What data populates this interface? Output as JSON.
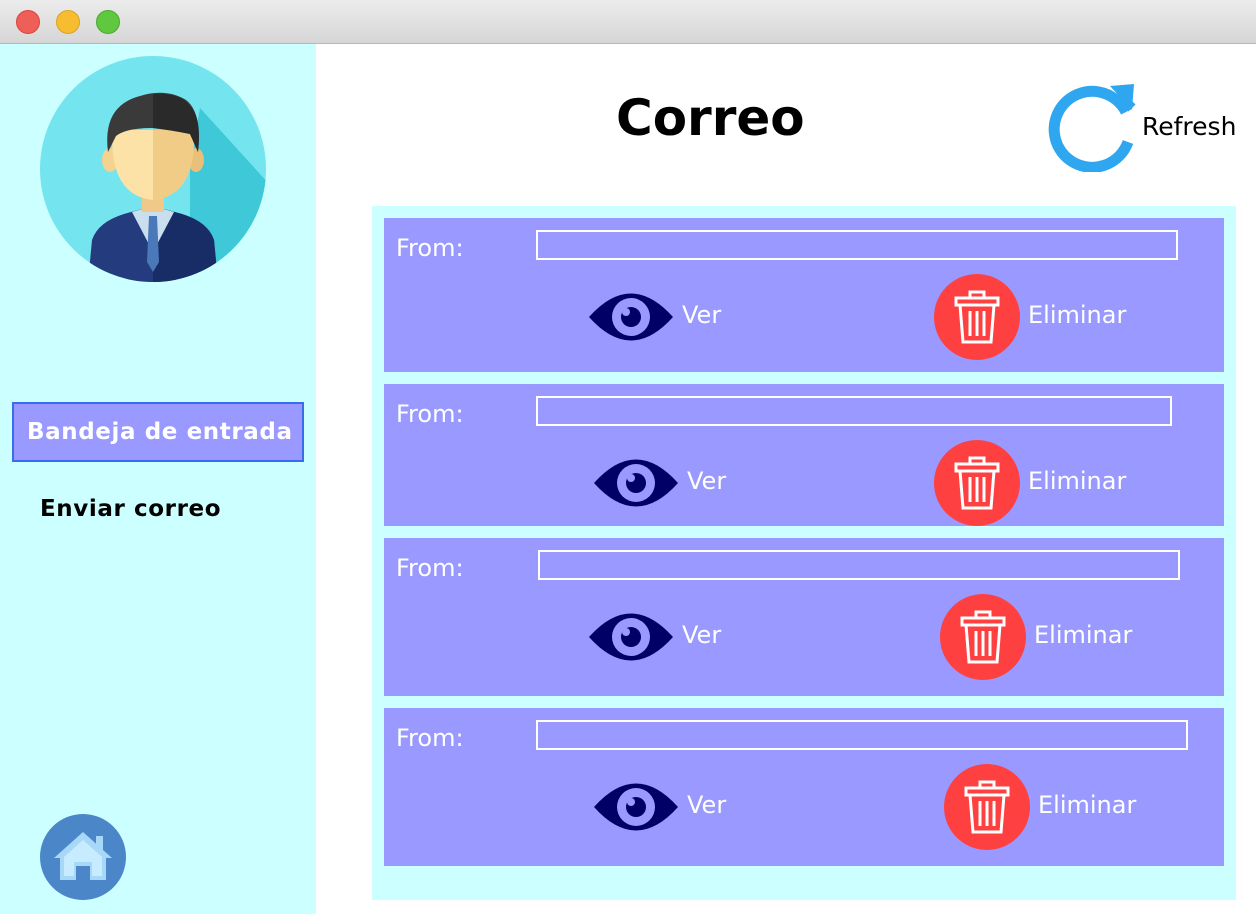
{
  "window": {
    "controls": [
      "close",
      "minimize",
      "maximize"
    ]
  },
  "sidebar": {
    "avatar_icon": "user-avatar-icon",
    "nav": [
      {
        "label": "Bandeja de entrada",
        "selected": true
      },
      {
        "label": "Enviar correo",
        "selected": false
      }
    ],
    "home_icon": "home-icon"
  },
  "header": {
    "title": "Correo",
    "refresh_label": "Refresh"
  },
  "mails": [
    {
      "from_label": "From:",
      "from_value": "",
      "view_label": "Ver",
      "delete_label": "Eliminar"
    },
    {
      "from_label": "From:",
      "from_value": "",
      "view_label": "Ver",
      "delete_label": "Eliminar"
    },
    {
      "from_label": "From:",
      "from_value": "",
      "view_label": "Ver",
      "delete_label": "Eliminar"
    },
    {
      "from_label": "From:",
      "from_value": "",
      "view_label": "Ver",
      "delete_label": "Eliminar"
    }
  ],
  "colors": {
    "sidebar_bg": "#ccffff",
    "card_bg": "#9999ff",
    "selected_border": "#3a6cf0",
    "eye_icon": "#000066",
    "delete_icon_bg": "#ff4040",
    "refresh_icon": "#2fa6f0",
    "home_icon_bg": "#4a86c8"
  }
}
